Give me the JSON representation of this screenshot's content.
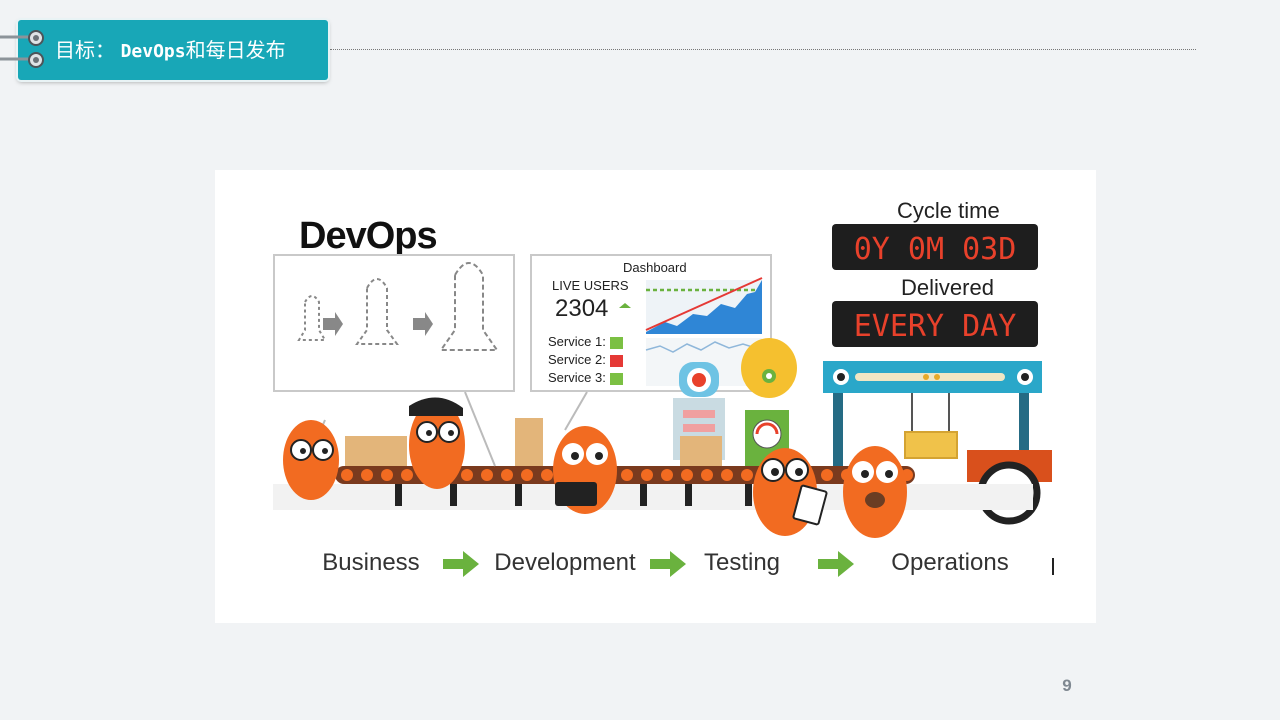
{
  "slide": {
    "title_prefix": "目标：",
    "title_code": "DevOps",
    "title_suffix": "和每日发布",
    "page_number": "9"
  },
  "illustration": {
    "heading": "DevOps",
    "dashboard": {
      "title": "Dashboard",
      "live_users_label": "LIVE USERS",
      "live_users_value": "2304",
      "services": [
        {
          "label": "Service 1:",
          "status_color": "#7bc043"
        },
        {
          "label": "Service 2:",
          "status_color": "#e53935"
        },
        {
          "label": "Service 3:",
          "status_color": "#7bc043"
        }
      ]
    },
    "cycle_time_label": "Cycle time",
    "cycle_time_value": "0Y 0M 03D",
    "delivered_label": "Delivered",
    "delivered_value": "EVERY DAY",
    "stages": [
      "Business",
      "Development",
      "Testing",
      "Operations"
    ],
    "colors": {
      "mascot": "#f26b21",
      "arrow": "#6ab23e",
      "led": "#e8412b",
      "teal": "#18a7b7"
    }
  }
}
